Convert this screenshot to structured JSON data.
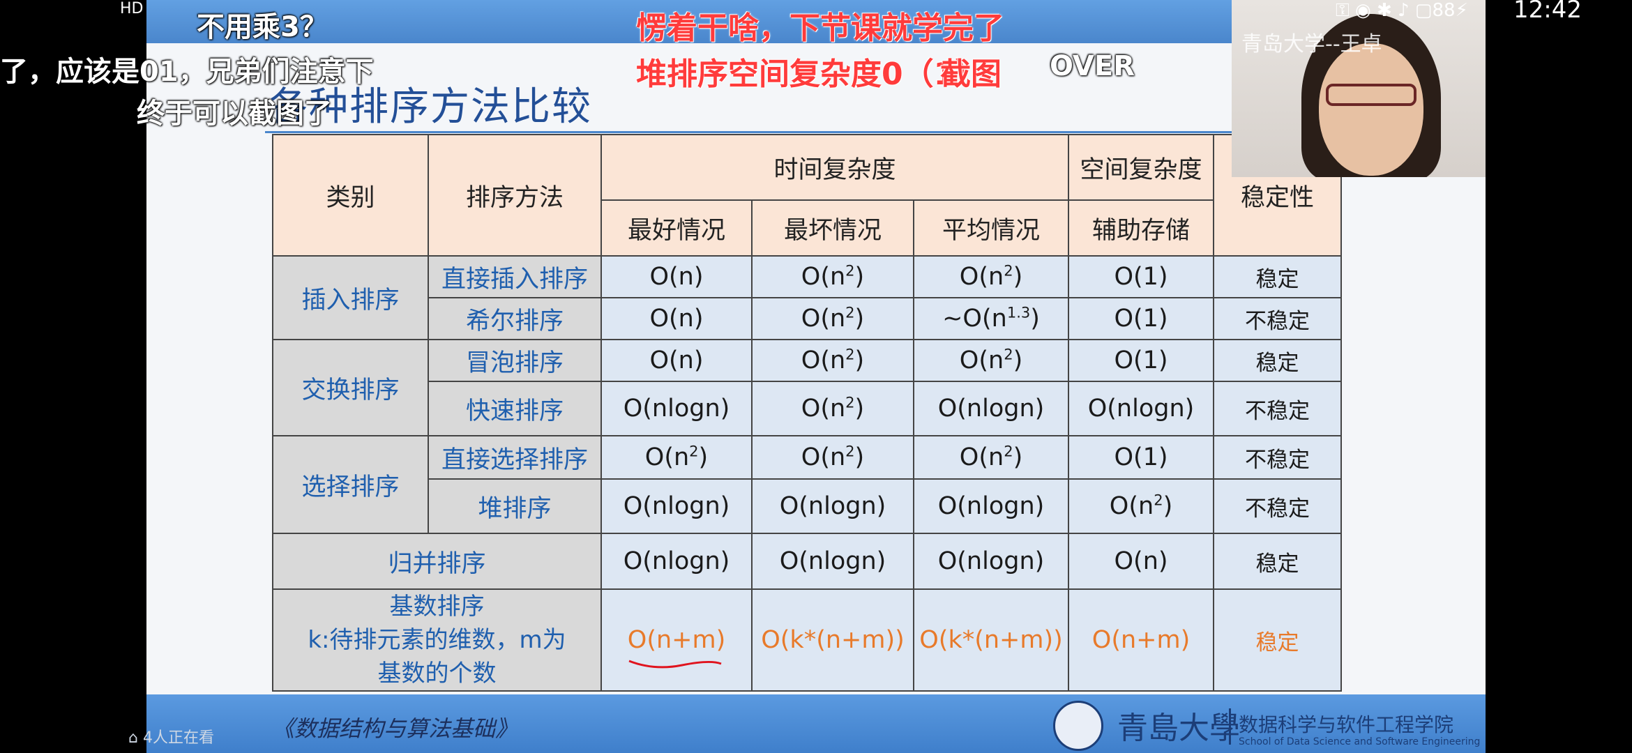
{
  "status_bar": {
    "left_text": "HD 2",
    "time": "12:42",
    "battery": "88"
  },
  "slide": {
    "title": "各种排序方法比较",
    "table": {
      "header": {
        "category": "类别",
        "method": "排序方法",
        "time": "时间复杂度",
        "space": "空间复杂度",
        "stability": "稳定性",
        "best": "最好情况",
        "worst": "最坏情况",
        "avg": "平均情况",
        "aux": "辅助存储"
      },
      "groups": {
        "insertion": "插入排序",
        "exchange": "交换排序",
        "selection": "选择排序"
      },
      "rows": [
        {
          "method": "直接插入排序",
          "best": "O(n)",
          "worst_base": "O(n",
          "worst_sup": "2",
          "worst_end": ")",
          "avg_base": "O(n",
          "avg_sup": "2",
          "avg_end": ")",
          "aux": "O(1)",
          "stability": "稳定"
        },
        {
          "method": "希尔排序",
          "best": "O(n)",
          "worst_base": "O(n",
          "worst_sup": "2",
          "worst_end": ")",
          "avg_base": "~O(n",
          "avg_sup": "1.3",
          "avg_end": ")",
          "aux": "O(1)",
          "stability": "不稳定"
        },
        {
          "method": "冒泡排序",
          "best": "O(n)",
          "worst_base": "O(n",
          "worst_sup": "2",
          "worst_end": ")",
          "avg_base": "O(n",
          "avg_sup": "2",
          "avg_end": ")",
          "aux": "O(1)",
          "stability": "稳定"
        },
        {
          "method": "快速排序",
          "best": "O(nlogn)",
          "worst_base": "O(n",
          "worst_sup": "2",
          "worst_end": ")",
          "avg": "O(nlogn)",
          "aux": "O(nlogn)",
          "stability": "不稳定"
        },
        {
          "method": "直接选择排序",
          "best_base": "O(n",
          "best_sup": "2",
          "best_end": ")",
          "worst_base": "O(n",
          "worst_sup": "2",
          "worst_end": ")",
          "avg_base": "O(n",
          "avg_sup": "2",
          "avg_end": ")",
          "aux": "O(1)",
          "stability": "不稳定"
        },
        {
          "method": "堆排序",
          "best": "O(nlogn)",
          "worst": "O(nlogn)",
          "avg": "O(nlogn)",
          "aux_base": "O(n",
          "aux_sup": "2",
          "aux_end": ")",
          "stability": "不稳定"
        },
        {
          "method": "归并排序",
          "best": "O(nlogn)",
          "worst": "O(nlogn)",
          "avg": "O(nlogn)",
          "aux": "O(n)",
          "stability": "稳定"
        },
        {
          "method_line1": "基数排序",
          "method_line2": "k:待排元素的维数，m为",
          "method_line3": "基数的个数",
          "best": "O(n+m)",
          "worst": "O(k*(n+m))",
          "avg": "O(k*(n+m))",
          "aux": "O(n+m)",
          "stability": "稳定"
        }
      ]
    },
    "footer": {
      "course": "《数据结构与算法基础》",
      "university": "青島大學",
      "school_cn": "数据科学与软件工程学院",
      "school_en": "School of Data Science and Software Engineering"
    },
    "viewers": "4人正在看"
  },
  "webcam": {
    "label": "青岛大学--王卓"
  },
  "danmaku": [
    {
      "text": "不用乘3？",
      "style": "white"
    },
    {
      "text": "了，应该是01，兄弟们注意下",
      "style": "white"
    },
    {
      "text": "终于可以截图了",
      "style": "white"
    },
    {
      "text": "愣着干啥，下节课就学完了",
      "style": "red"
    },
    {
      "text": "堆排序空间复杂度0（1）",
      "style": "red"
    },
    {
      "text": "截图",
      "style": "red"
    },
    {
      "text": "OVER",
      "style": "white"
    }
  ],
  "colors": {
    "slide_blue": "#4a86cc",
    "header_bg": "#fbe5d6",
    "cell_bg": "#dde7f3",
    "method_bg": "#d9d9d9",
    "highlight": "#e87a2a"
  }
}
